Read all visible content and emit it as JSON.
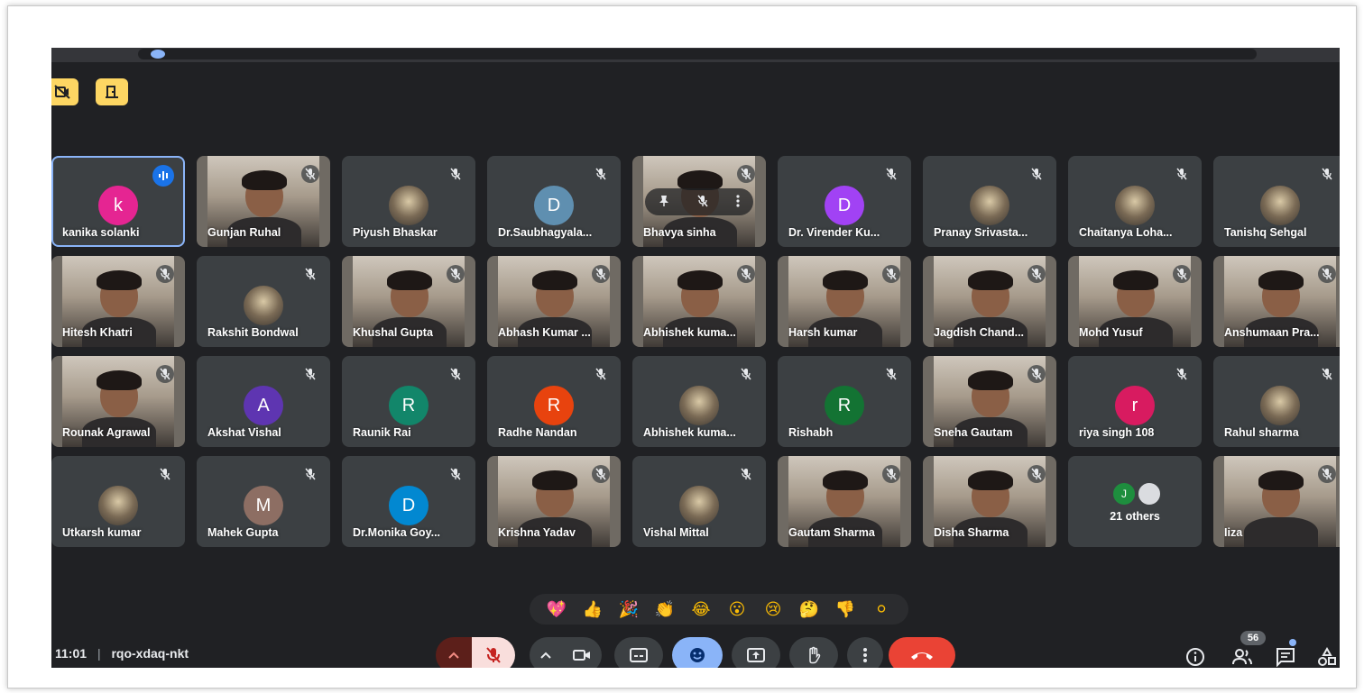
{
  "meeting": {
    "time": "11:01",
    "separator": "|",
    "code": "rqo-xdaq-nkt"
  },
  "colors": {
    "background": "#202124",
    "tile": "#3c4043",
    "accent_yellow": "#fdd663",
    "end_call": "#ea4335",
    "active_blue": "#8ab4f8",
    "speaking_outline": "#8ab4f8"
  },
  "participants": [
    {
      "name": "kanika solanki",
      "initial": "k",
      "avatar_color": "#e52592",
      "type": "avatar",
      "speaking": true
    },
    {
      "name": "Gunjan Ruhal",
      "type": "video"
    },
    {
      "name": "Piyush Bhaskar",
      "type": "photo"
    },
    {
      "name": "Dr.Saubhagyala...",
      "initial": "D",
      "avatar_color": "#5f8fb0",
      "type": "avatar"
    },
    {
      "name": "Bhavya sinha",
      "type": "video",
      "hover": true
    },
    {
      "name": "Dr. Virender Ku...",
      "initial": "D",
      "avatar_color": "#a142f4",
      "type": "avatar"
    },
    {
      "name": "Pranay Srivasta...",
      "type": "photo"
    },
    {
      "name": "Chaitanya Loha...",
      "type": "photo"
    },
    {
      "name": "Tanishq Sehgal",
      "type": "photo"
    },
    {
      "name": "Hitesh Khatri",
      "type": "video"
    },
    {
      "name": "Rakshit Bondwal",
      "type": "photo"
    },
    {
      "name": "Khushal Gupta",
      "type": "video"
    },
    {
      "name": "Abhash Kumar ...",
      "type": "video"
    },
    {
      "name": "Abhishek kuma...",
      "type": "video"
    },
    {
      "name": "Harsh kumar",
      "type": "video"
    },
    {
      "name": "Jagdish Chand...",
      "type": "video"
    },
    {
      "name": "Mohd Yusuf",
      "type": "video"
    },
    {
      "name": "Anshumaan Pra...",
      "type": "video"
    },
    {
      "name": "Rounak Agrawal",
      "type": "video"
    },
    {
      "name": "Akshat Vishal",
      "initial": "A",
      "avatar_color": "#5e35b1",
      "type": "avatar"
    },
    {
      "name": "Raunik Rai",
      "initial": "R",
      "avatar_color": "#12866a",
      "type": "avatar"
    },
    {
      "name": "Radhe Nandan",
      "initial": "R",
      "avatar_color": "#e8430e",
      "type": "avatar"
    },
    {
      "name": "Abhishek kuma...",
      "type": "photo"
    },
    {
      "name": "Rishabh",
      "initial": "R",
      "avatar_color": "#137333",
      "type": "avatar"
    },
    {
      "name": "Sneha Gautam",
      "type": "video"
    },
    {
      "name": "riya singh 108",
      "initial": "r",
      "avatar_color": "#d81b60",
      "type": "avatar"
    },
    {
      "name": "Rahul sharma",
      "type": "photo"
    },
    {
      "name": "Utkarsh kumar",
      "type": "photo"
    },
    {
      "name": "Mahek Gupta",
      "initial": "M",
      "avatar_color": "#8d6e63",
      "type": "avatar"
    },
    {
      "name": "Dr.Monika Goy...",
      "initial": "D",
      "avatar_color": "#0288d1",
      "type": "avatar"
    },
    {
      "name": "Krishna Yadav",
      "type": "video"
    },
    {
      "name": "Vishal Mittal",
      "type": "photo"
    },
    {
      "name": "Gautam Sharma",
      "type": "video"
    },
    {
      "name": "Disha Sharma",
      "type": "video"
    },
    {
      "name": "21 others",
      "type": "others",
      "mini_initial": "J",
      "mini_color": "#1e8e3e"
    },
    {
      "name": "Iiza",
      "type": "video"
    }
  ],
  "reactions": [
    "💖",
    "👍",
    "🎉",
    "👏",
    "😂",
    "😮",
    "😢",
    "🤔",
    "👎",
    "⚪"
  ],
  "controls": {
    "left": [
      "more-options-chevron",
      "microphone-off",
      "camera-chevron",
      "camera",
      "captions",
      "emoji",
      "present",
      "raise-hand",
      "more-vert",
      "end-call"
    ],
    "right": [
      "info",
      "people",
      "chat",
      "activities"
    ]
  },
  "participant_count": "56"
}
